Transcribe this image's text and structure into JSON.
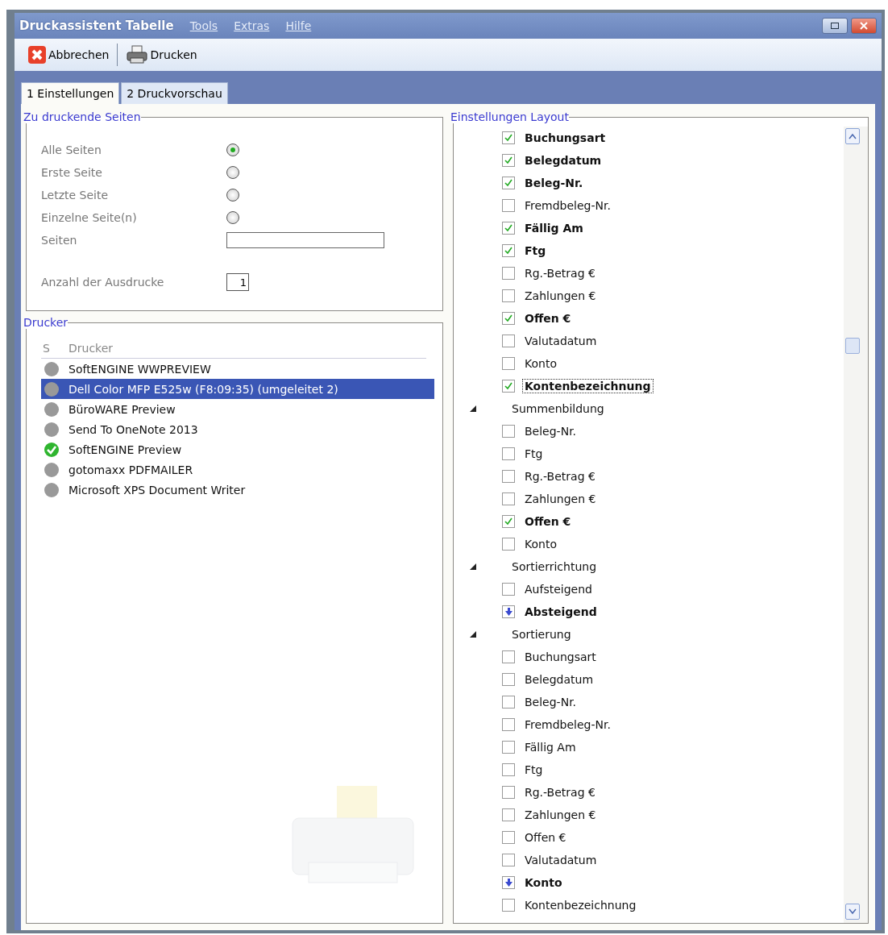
{
  "window": {
    "title": "Druckassistent Tabelle"
  },
  "menu": [
    "Tools",
    "Extras",
    "Hilfe"
  ],
  "toolbar": [
    {
      "kind": "cancel",
      "label": "Abbrechen"
    },
    {
      "kind": "print",
      "label": "Drucken"
    }
  ],
  "tabs": [
    {
      "label": "1 Einstellungen",
      "selected": true
    },
    {
      "label": "2 Druckvorschau",
      "selected": false
    }
  ],
  "pages": {
    "title": "Zu druckende Seiten",
    "options": [
      {
        "label": "Alle Seiten",
        "selected": true
      },
      {
        "label": "Erste Seite",
        "selected": false
      },
      {
        "label": "Letzte Seite",
        "selected": false
      },
      {
        "label": "Einzelne Seite(n)",
        "selected": false
      }
    ],
    "pages_label": "Seiten",
    "copies_label": "Anzahl der Ausdrucke",
    "copies": "1"
  },
  "printers": {
    "title": "Drucker",
    "columns": [
      "S",
      "Drucker"
    ],
    "rows": [
      {
        "name": "SoftENGINE WWPREVIEW",
        "selected": false,
        "default": false
      },
      {
        "name": "Dell Color MFP E525w (F8:09:35) (umgeleitet 2)",
        "selected": true,
        "default": false
      },
      {
        "name": "BüroWARE Preview",
        "selected": false,
        "default": false
      },
      {
        "name": "Send To OneNote 2013",
        "selected": false,
        "default": false
      },
      {
        "name": "SoftENGINE Preview",
        "selected": false,
        "default": true
      },
      {
        "name": "gotomaxx PDFMAILER",
        "selected": false,
        "default": false
      },
      {
        "name": "Microsoft XPS Document Writer",
        "selected": false,
        "default": false
      }
    ]
  },
  "layout": {
    "title": "Einstellungen Layout",
    "items": [
      {
        "kind": "checkbox",
        "label": "Buchungsart",
        "checked": true
      },
      {
        "kind": "checkbox",
        "label": "Belegdatum",
        "checked": true
      },
      {
        "kind": "checkbox",
        "label": "Beleg-Nr.",
        "checked": true
      },
      {
        "kind": "checkbox",
        "label": "Fremdbeleg-Nr.",
        "checked": false
      },
      {
        "kind": "checkbox",
        "label": "Fällig Am",
        "checked": true
      },
      {
        "kind": "checkbox",
        "label": "Ftg",
        "checked": true
      },
      {
        "kind": "checkbox",
        "label": "Rg.-Betrag €",
        "checked": false
      },
      {
        "kind": "checkbox",
        "label": "Zahlungen €",
        "checked": false
      },
      {
        "kind": "checkbox",
        "label": "Offen €",
        "checked": true
      },
      {
        "kind": "checkbox",
        "label": "Valutadatum",
        "checked": false
      },
      {
        "kind": "checkbox",
        "label": "Konto",
        "checked": false
      },
      {
        "kind": "checkbox",
        "label": "Kontenbezeichnung",
        "checked": true,
        "focused": true
      },
      {
        "kind": "group",
        "label": "Summenbildung",
        "expanded": true,
        "children": [
          {
            "kind": "checkbox",
            "label": "Beleg-Nr.",
            "checked": false
          },
          {
            "kind": "checkbox",
            "label": "Ftg",
            "checked": false
          },
          {
            "kind": "checkbox",
            "label": "Rg.-Betrag €",
            "checked": false
          },
          {
            "kind": "checkbox",
            "label": "Zahlungen €",
            "checked": false
          },
          {
            "kind": "checkbox",
            "label": "Offen €",
            "checked": true
          },
          {
            "kind": "checkbox",
            "label": "Konto",
            "checked": false
          }
        ]
      },
      {
        "kind": "group",
        "label": "Sortierrichtung",
        "expanded": true,
        "children": [
          {
            "kind": "option",
            "label": "Aufsteigend",
            "selected": false
          },
          {
            "kind": "option",
            "label": "Absteigend",
            "selected": true
          }
        ]
      },
      {
        "kind": "group",
        "label": "Sortierung",
        "expanded": true,
        "children": [
          {
            "kind": "option",
            "label": "Buchungsart",
            "selected": false
          },
          {
            "kind": "option",
            "label": "Belegdatum",
            "selected": false
          },
          {
            "kind": "option",
            "label": "Beleg-Nr.",
            "selected": false
          },
          {
            "kind": "option",
            "label": "Fremdbeleg-Nr.",
            "selected": false
          },
          {
            "kind": "option",
            "label": "Fällig Am",
            "selected": false
          },
          {
            "kind": "option",
            "label": "Ftg",
            "selected": false
          },
          {
            "kind": "option",
            "label": "Rg.-Betrag €",
            "selected": false
          },
          {
            "kind": "option",
            "label": "Zahlungen €",
            "selected": false
          },
          {
            "kind": "option",
            "label": "Offen €",
            "selected": false
          },
          {
            "kind": "option",
            "label": "Valutadatum",
            "selected": false
          },
          {
            "kind": "option",
            "label": "Konto",
            "selected": true
          },
          {
            "kind": "option",
            "label": "Kontenbezeichnung",
            "selected": false
          }
        ]
      }
    ]
  }
}
